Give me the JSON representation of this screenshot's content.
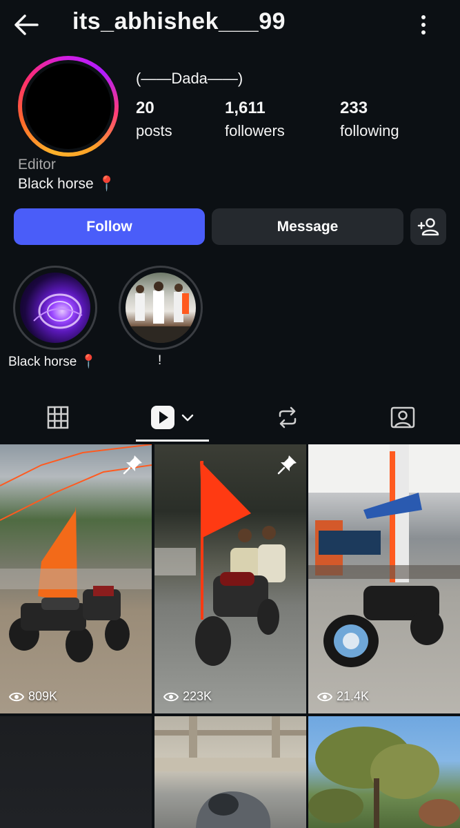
{
  "header": {
    "username": "its_abhishek___99",
    "back_icon": "arrow-left",
    "more_icon": "vertical-dots"
  },
  "profile": {
    "display_name": "(——Dada——)",
    "stats": [
      {
        "value": "20",
        "label": "posts"
      },
      {
        "value": "1,611",
        "label": "followers"
      },
      {
        "value": "233",
        "label": "following"
      }
    ],
    "category": "Editor",
    "bio": "Black horse",
    "bio_emoji": "📍"
  },
  "actions": {
    "follow_label": "Follow",
    "message_label": "Message",
    "add_user_icon": "add-user"
  },
  "highlights": [
    {
      "label": "Black horse",
      "emoji": "📍"
    },
    {
      "label": "!"
    }
  ],
  "tabs": [
    {
      "icon": "grid",
      "selected": false
    },
    {
      "icon": "reels",
      "selected": true
    },
    {
      "icon": "reposts",
      "selected": false
    },
    {
      "icon": "tagged",
      "selected": false
    }
  ],
  "grid": [
    {
      "views": "809K",
      "pinned": true
    },
    {
      "views": "223K",
      "pinned": true
    },
    {
      "views": "21.4K",
      "pinned": false
    },
    {
      "views": "",
      "pinned": false
    },
    {
      "views": "",
      "pinned": false
    },
    {
      "views": "",
      "pinned": false
    }
  ],
  "colors": {
    "background": "#0c1014",
    "follow_button": "#4a5df9",
    "secondary_button": "#25292e",
    "muted_text": "#a8a8a8"
  }
}
